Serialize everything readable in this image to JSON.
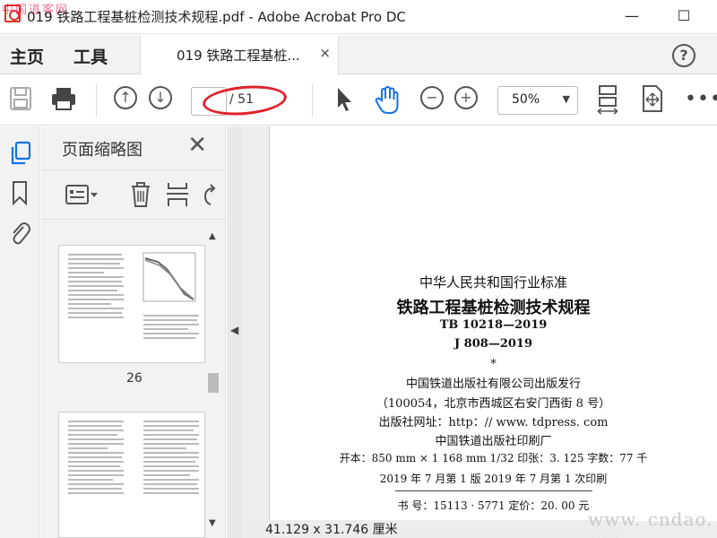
{
  "watermark_top": "中国道客网",
  "window": {
    "title": "019 铁路工程基桩检测技术规程.pdf - Adobe Acrobat Pro DC",
    "minimize": "—",
    "maximize": "☐"
  },
  "tabs": {
    "home": "主页",
    "tools": "工具",
    "document": "019 铁路工程基桩...",
    "close": "×"
  },
  "toolbar": {
    "page_current": "",
    "page_total": "/ 51",
    "zoom": "50%"
  },
  "thumbnail_panel": {
    "title": "页面缩略图",
    "close": "✕",
    "page_label": "26"
  },
  "document_page": {
    "line1": "中华人民共和国行业标准",
    "line2": "铁路工程基桩检测技术规程",
    "line3": "TB 10218—2019",
    "line4": "J 808—2019",
    "line5": "*",
    "line6": "中国铁道出版社有限公司出版发行",
    "line7": "（100054，北京市西城区右安门西街 8 号）",
    "line8": "出版社网址：http：// www. tdpress. com",
    "line9": "中国铁道出版社印刷厂",
    "line10": "开本：850 mm × 1 168 mm  1/32  印张：3. 125  字数：77 千",
    "line11": "2019 年 7 月第 1 版  2019 年 7 月第 1 次印刷",
    "line12": "书  号：15113 · 5771      定价：20. 00 元"
  },
  "status": {
    "dimensions": "41.129 x 31.746 厘米"
  },
  "watermark_bottom": "www. cndao. com",
  "colors": {
    "accent_blue": "#1473e6",
    "annotation_red": "#e0222a"
  }
}
